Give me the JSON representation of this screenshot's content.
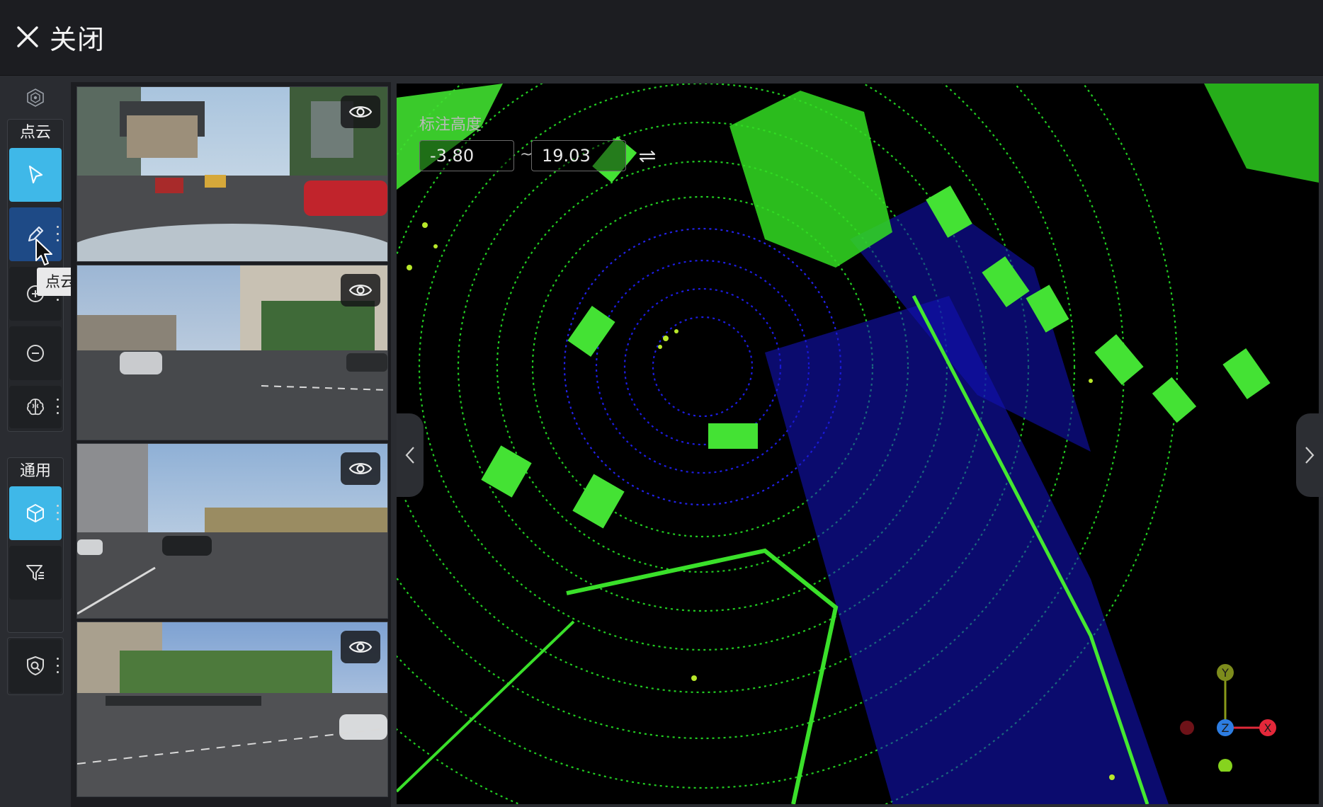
{
  "topbar": {
    "close_label": "关闭",
    "close_icon": "close-x-icon"
  },
  "toolbar": {
    "groups": [
      {
        "title": "点云"
      },
      {
        "title": "通用"
      }
    ],
    "tooltip": "点云分割 (F)",
    "active_color": "#3fb8e8",
    "selected_color": "#1e4a86"
  },
  "cameras": [
    {
      "label": "front-camera"
    },
    {
      "label": "left-camera"
    },
    {
      "label": "right-camera"
    },
    {
      "label": "rear-camera"
    }
  ],
  "viewport": {
    "height_label": "标注高度",
    "height_min": "-3.80",
    "height_max": "19.03",
    "separator": "~",
    "point_colors": {
      "ground": "#1818e6",
      "object": "#22dd22"
    },
    "axis": {
      "y": "Y",
      "z": "Z",
      "x": "X"
    }
  }
}
